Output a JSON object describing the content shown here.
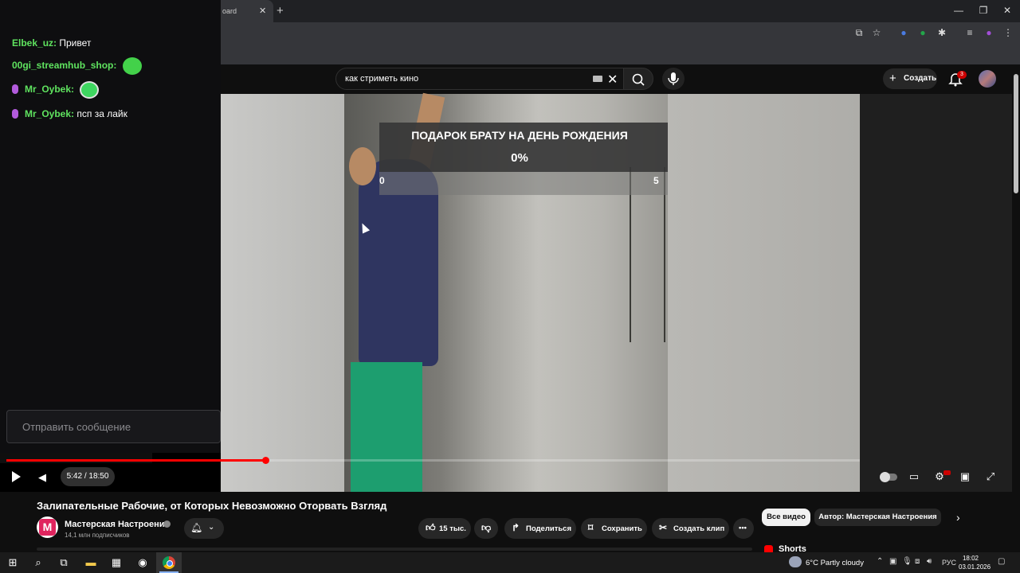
{
  "browser": {
    "tab_title": "oard",
    "tab_close": "✕",
    "new_tab": "+",
    "win_min": "—",
    "win_max": "❐",
    "win_close": "✕"
  },
  "youtube": {
    "search_value": "как стриметь кино",
    "create_label": "Создать",
    "notifications_count": "3"
  },
  "overlay": {
    "goal_title": "ПОДАРОК БРАТУ НА ДЕНЬ РОЖДЕНИЯ",
    "goal_percent": "0%",
    "goal_min": "0",
    "goal_max": "5"
  },
  "player": {
    "time": "5:42 / 18:50",
    "progress_fraction": 0.303
  },
  "video": {
    "title": "Залипательные Рабочие, от Которых Невозможно Оторвать Взгляд",
    "channel": "Мастерская Настроения",
    "subscribers": "14,1 млн подписчиков",
    "likes": "15 тыс.",
    "share": "Поделиться",
    "save": "Сохранить",
    "clip": "Создать клип",
    "more": "•••"
  },
  "related": {
    "chip_all": "Все видео",
    "chip_author": "Автор: Мастерская Настроения",
    "shorts": "Shorts"
  },
  "chat": {
    "messages": [
      {
        "user": "Elbek_uz:",
        "text": "Привет"
      },
      {
        "user": "00gi_streamhub_shop:",
        "text": ""
      },
      {
        "user": "Mr_Oybek:",
        "text": ""
      },
      {
        "user": "Mr_Oybek:",
        "text": "псп за лайк"
      }
    ],
    "input_placeholder": "Отправить сообщение"
  },
  "taskbar": {
    "weather": "6°C  Partly cloudy",
    "lang": "РУС",
    "time": "18:02",
    "date": "03.01.2026"
  }
}
